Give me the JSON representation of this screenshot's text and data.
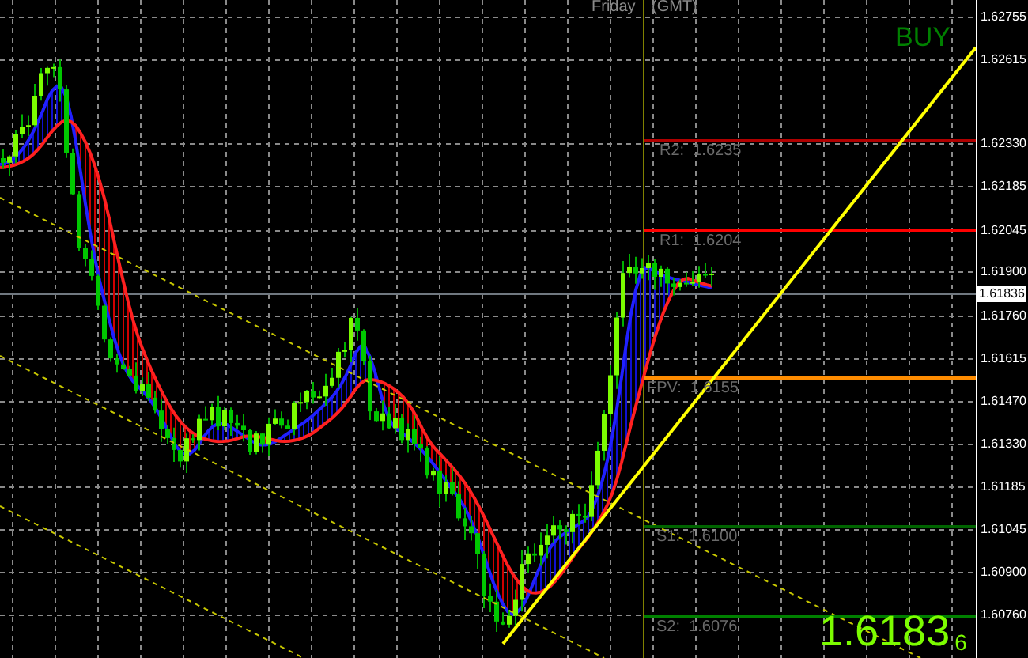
{
  "header": {
    "day": "Friday",
    "timezone": "(GMT)"
  },
  "signal": {
    "label": "BUY"
  },
  "levels": [
    {
      "label": "R2:  1.6235",
      "color": "#b00000"
    },
    {
      "label": "R1:  1.6204",
      "color": "#ff0000"
    },
    {
      "label": "FPV:  1.6155",
      "color": "#ff8c00"
    },
    {
      "label": "S1:  1.6100",
      "color": "#006400"
    },
    {
      "label": "S2:  1.6076",
      "color": "#008000"
    }
  ],
  "price_axis": {
    "ticks": [
      "1.62755",
      "1.62615",
      "1.62330",
      "1.62185",
      "1.62045",
      "1.61900",
      "1.61760",
      "1.61615",
      "1.61470",
      "1.61330",
      "1.61185",
      "1.61045",
      "1.60900",
      "1.60760"
    ],
    "current": "1.61836"
  },
  "quote": {
    "price": "1.6183",
    "last_digit": "6"
  }
}
